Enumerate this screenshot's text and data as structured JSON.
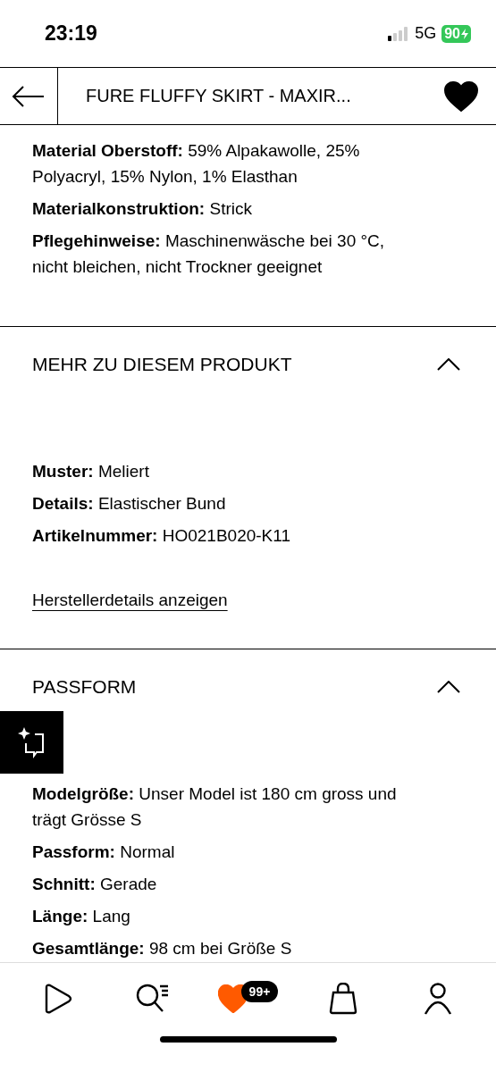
{
  "status_bar": {
    "time": "23:19",
    "network": "5G",
    "battery": "90"
  },
  "header": {
    "title": "FURE FLUFFY SKIRT - MAXIR...",
    "favorite": true
  },
  "sections": [
    {
      "facts": [
        {
          "label": "Material Oberstoff:",
          "value": "59% Alpakawolle, 25% Polyacryl, 15% Nylon, 1% Elasthan"
        },
        {
          "label": "Materialkonstruktion:",
          "value": "Strick"
        },
        {
          "label": "Pflegehinweise:",
          "value": "Maschinenwäsche bei 30 °C, nicht bleichen, nicht Trockner geeignet"
        }
      ]
    },
    {
      "title": "MEHR ZU DIESEM PRODUKT",
      "expanded": true,
      "facts": [
        {
          "label": "Muster:",
          "value": "Meliert"
        },
        {
          "label": "Details:",
          "value": "Elastischer Bund"
        },
        {
          "label": "Artikelnummer:",
          "value": "HO021B020-K11"
        }
      ],
      "link": "Herstellerdetails anzeigen"
    },
    {
      "title": "PASSFORM",
      "expanded": true,
      "facts": [
        {
          "label": "Modelgröße:",
          "value": "Unser Model ist 180 cm gross und trägt Grösse S"
        },
        {
          "label": "Passform:",
          "value": "Normal"
        },
        {
          "label": "Schnitt:",
          "value": "Gerade"
        },
        {
          "label": "Länge:",
          "value": "Lang"
        },
        {
          "label": "Gesamtlänge:",
          "value": "98 cm bei Größe S"
        }
      ]
    }
  ],
  "nav": [
    {
      "kind": "home",
      "selected": false
    },
    {
      "kind": "search",
      "selected": false
    },
    {
      "kind": "wishlist",
      "selected": true,
      "badge": "99+"
    },
    {
      "kind": "bag",
      "selected": false
    },
    {
      "kind": "profile",
      "selected": false
    }
  ]
}
